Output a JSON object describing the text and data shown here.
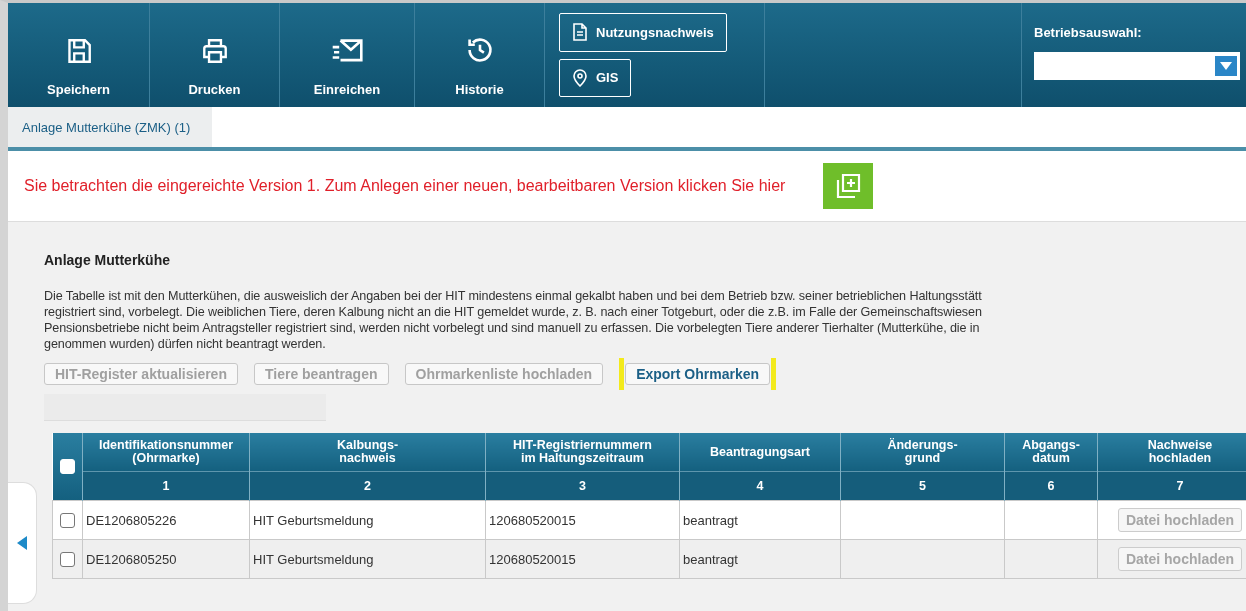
{
  "toolbar": {
    "buttons": [
      {
        "kind": "save",
        "label": "Speichern"
      },
      {
        "kind": "print",
        "label": "Drucken"
      },
      {
        "kind": "submit",
        "label": "Einreichen"
      },
      {
        "kind": "history",
        "label": "Historie"
      }
    ],
    "links": [
      {
        "kind": "document",
        "label": "Nutzungsnachweis"
      },
      {
        "kind": "location",
        "label": "GIS"
      }
    ],
    "farm_select": {
      "label": "Betriebsauswahl:"
    }
  },
  "tabs": [
    {
      "label": "Anlage Mutterkühe (ZMK) (1)",
      "selected": true
    }
  ],
  "notice": {
    "text": "Sie betrachten die eingereichte Version 1. Zum Anlegen einer neuen, bearbeitbaren Version klicken Sie hier"
  },
  "section": {
    "title": "Anlage Mutterkühe",
    "description_lines": [
      "Die Tabelle ist mit den Mutterkühen, die ausweislich der Angaben bei der HIT mindestens einmal gekalbt haben und bei dem Betrieb bzw. seiner betrieblichen Haltungsstätt",
      "registriert sind, vorbelegt. Die weiblichen Tiere, deren Kalbung nicht an die HIT gemeldet wurde, z. B. nach einer Totgeburt, oder die z.B. im Falle der Gemeinschaftswiesen",
      "Pensionsbetriebe nicht beim Antragsteller registriert sind, werden nicht vorbelegt und sind manuell zu erfassen. Die vorbelegten Tiere anderer Tierhalter (Mutterkühe, die in",
      "genommen wurden) dürfen nicht beantragt werden."
    ],
    "actions": [
      {
        "label": "HIT-Register aktualisieren",
        "disabled": true,
        "highlighted": false
      },
      {
        "label": "Tiere beantragen",
        "disabled": true,
        "highlighted": false
      },
      {
        "label": "Ohrmarkenliste hochladen",
        "disabled": true,
        "highlighted": false
      },
      {
        "label": "Export Ohrmarken",
        "disabled": false,
        "highlighted": true
      }
    ]
  },
  "table": {
    "select_all": {
      "checked": false
    },
    "columns": [
      {
        "label": "Identifikationsnummer\n(Ohrmarke)",
        "number": "1"
      },
      {
        "label": "Kalbungs-\nnachweis",
        "number": "2"
      },
      {
        "label": "HIT-Registriernummern\nim Haltungszeitraum",
        "number": "3"
      },
      {
        "label": "Beantragungsart",
        "number": "4"
      },
      {
        "label": "Änderungs-\ngrund",
        "number": "5"
      },
      {
        "label": "Abgangs-\ndatum",
        "number": "6"
      },
      {
        "label": "Nachweise\nhochladen",
        "number": "7"
      }
    ],
    "rows": [
      {
        "checked": false,
        "cells": [
          "DE1206805226",
          "HIT Geburtsmeldung",
          "120680520015",
          "beantragt",
          "",
          ""
        ],
        "upload": {
          "label": "Datei hochladen",
          "disabled": true
        }
      },
      {
        "checked": false,
        "cells": [
          "DE1206805250",
          "HIT Geburtsmeldung",
          "120680520015",
          "beantragt",
          "",
          ""
        ],
        "upload": {
          "label": "Datei hochladen",
          "disabled": true
        }
      }
    ]
  }
}
